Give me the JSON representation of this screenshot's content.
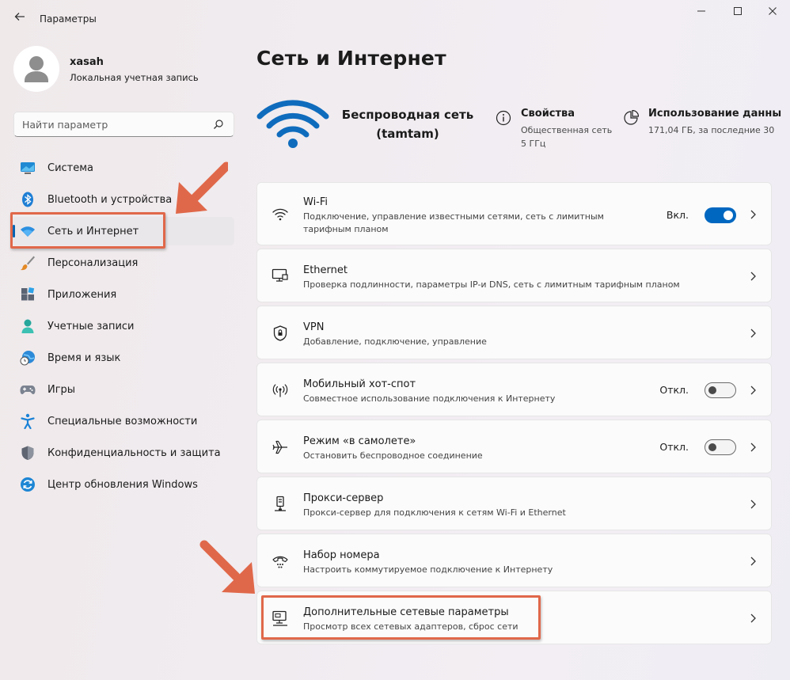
{
  "window": {
    "title": "Параметры",
    "minimize_label": "—",
    "maximize_label": "☐",
    "close_label": "✕"
  },
  "user": {
    "name": "xasah",
    "account_type": "Локальная учетная запись"
  },
  "search": {
    "placeholder": "Найти параметр"
  },
  "sidebar": {
    "items": [
      {
        "label": "Система",
        "icon": "system-icon"
      },
      {
        "label": "Bluetooth и устройства",
        "icon": "bluetooth-icon"
      },
      {
        "label": "Сеть и Интернет",
        "icon": "wifi-icon",
        "active": true
      },
      {
        "label": "Персонализация",
        "icon": "brush-icon"
      },
      {
        "label": "Приложения",
        "icon": "apps-icon"
      },
      {
        "label": "Учетные записи",
        "icon": "account-icon"
      },
      {
        "label": "Время и язык",
        "icon": "globe-clock-icon"
      },
      {
        "label": "Игры",
        "icon": "gamepad-icon"
      },
      {
        "label": "Специальные возможности",
        "icon": "accessibility-icon"
      },
      {
        "label": "Конфиденциальность и защита",
        "icon": "shield-icon"
      },
      {
        "label": "Центр обновления Windows",
        "icon": "update-icon"
      }
    ]
  },
  "main": {
    "title": "Сеть и Интернет",
    "connection": {
      "name_line1": "Беспроводная сеть",
      "name_line2": "(tamtam)"
    },
    "properties": {
      "title": "Свойства",
      "line1": "Общественная сеть",
      "line2": "5 ГГц"
    },
    "data_usage": {
      "title": "Использование данны",
      "line1": "171,04 ГБ, за последние 30"
    },
    "cards": [
      {
        "title": "Wi-Fi",
        "desc": "Подключение, управление известными сетями, сеть с лимитным тарифным планом",
        "icon": "wifi-icon",
        "toggle_label": "Вкл.",
        "toggle": "on"
      },
      {
        "title": "Ethernet",
        "desc": "Проверка подлинности, параметры IP-и DNS, сеть с лимитным тарифным планом",
        "icon": "ethernet-icon"
      },
      {
        "title": "VPN",
        "desc": "Добавление, подключение, управление",
        "icon": "vpn-shield-icon"
      },
      {
        "title": "Мобильный хот-спот",
        "desc": "Совместное использование подключения к Интернету",
        "icon": "hotspot-icon",
        "toggle_label": "Откл.",
        "toggle": "off"
      },
      {
        "title": "Режим «в самолете»",
        "desc": "Остановить беспроводное соединение",
        "icon": "airplane-icon",
        "toggle_label": "Откл.",
        "toggle": "off"
      },
      {
        "title": "Прокси-сервер",
        "desc": "Прокси-сервер для подключения к сетям Wi-Fi и Ethernet",
        "icon": "proxy-icon"
      },
      {
        "title": "Набор номера",
        "desc": "Настроить коммутируемое подключение к Интернету",
        "icon": "dialup-icon"
      },
      {
        "title": "Дополнительные сетевые параметры",
        "desc": "Просмотр всех сетевых адаптеров, сброс сети",
        "icon": "network-adapter-icon"
      }
    ]
  },
  "colors": {
    "accent": "#0067c0",
    "highlight": "#e0684a"
  }
}
